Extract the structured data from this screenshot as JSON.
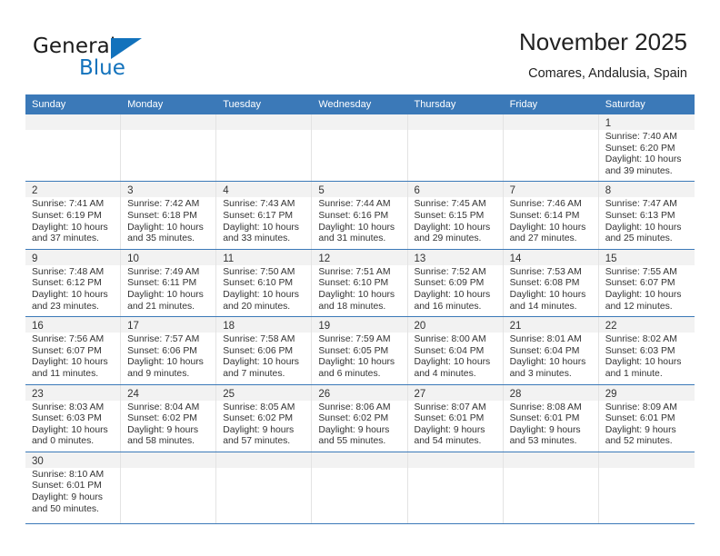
{
  "brand": {
    "name_top": "General",
    "name_bottom": "Blue",
    "accent_color": "#1272bc"
  },
  "header": {
    "title": "November 2025",
    "subtitle": "Comares, Andalusia, Spain"
  },
  "calendar": {
    "header_bg": "#3b79b8",
    "weekdays": [
      "Sunday",
      "Monday",
      "Tuesday",
      "Wednesday",
      "Thursday",
      "Friday",
      "Saturday"
    ],
    "weeks": [
      [
        {
          "day": "",
          "sunrise": "",
          "sunset": "",
          "daylight": "",
          "empty": true
        },
        {
          "day": "",
          "sunrise": "",
          "sunset": "",
          "daylight": "",
          "empty": true
        },
        {
          "day": "",
          "sunrise": "",
          "sunset": "",
          "daylight": "",
          "empty": true
        },
        {
          "day": "",
          "sunrise": "",
          "sunset": "",
          "daylight": "",
          "empty": true
        },
        {
          "day": "",
          "sunrise": "",
          "sunset": "",
          "daylight": "",
          "empty": true
        },
        {
          "day": "",
          "sunrise": "",
          "sunset": "",
          "daylight": "",
          "empty": true
        },
        {
          "day": "1",
          "sunrise": "Sunrise: 7:40 AM",
          "sunset": "Sunset: 6:20 PM",
          "daylight": "Daylight: 10 hours and 39 minutes.",
          "empty": false
        }
      ],
      [
        {
          "day": "2",
          "sunrise": "Sunrise: 7:41 AM",
          "sunset": "Sunset: 6:19 PM",
          "daylight": "Daylight: 10 hours and 37 minutes.",
          "empty": false
        },
        {
          "day": "3",
          "sunrise": "Sunrise: 7:42 AM",
          "sunset": "Sunset: 6:18 PM",
          "daylight": "Daylight: 10 hours and 35 minutes.",
          "empty": false
        },
        {
          "day": "4",
          "sunrise": "Sunrise: 7:43 AM",
          "sunset": "Sunset: 6:17 PM",
          "daylight": "Daylight: 10 hours and 33 minutes.",
          "empty": false
        },
        {
          "day": "5",
          "sunrise": "Sunrise: 7:44 AM",
          "sunset": "Sunset: 6:16 PM",
          "daylight": "Daylight: 10 hours and 31 minutes.",
          "empty": false
        },
        {
          "day": "6",
          "sunrise": "Sunrise: 7:45 AM",
          "sunset": "Sunset: 6:15 PM",
          "daylight": "Daylight: 10 hours and 29 minutes.",
          "empty": false
        },
        {
          "day": "7",
          "sunrise": "Sunrise: 7:46 AM",
          "sunset": "Sunset: 6:14 PM",
          "daylight": "Daylight: 10 hours and 27 minutes.",
          "empty": false
        },
        {
          "day": "8",
          "sunrise": "Sunrise: 7:47 AM",
          "sunset": "Sunset: 6:13 PM",
          "daylight": "Daylight: 10 hours and 25 minutes.",
          "empty": false
        }
      ],
      [
        {
          "day": "9",
          "sunrise": "Sunrise: 7:48 AM",
          "sunset": "Sunset: 6:12 PM",
          "daylight": "Daylight: 10 hours and 23 minutes.",
          "empty": false
        },
        {
          "day": "10",
          "sunrise": "Sunrise: 7:49 AM",
          "sunset": "Sunset: 6:11 PM",
          "daylight": "Daylight: 10 hours and 21 minutes.",
          "empty": false
        },
        {
          "day": "11",
          "sunrise": "Sunrise: 7:50 AM",
          "sunset": "Sunset: 6:10 PM",
          "daylight": "Daylight: 10 hours and 20 minutes.",
          "empty": false
        },
        {
          "day": "12",
          "sunrise": "Sunrise: 7:51 AM",
          "sunset": "Sunset: 6:10 PM",
          "daylight": "Daylight: 10 hours and 18 minutes.",
          "empty": false
        },
        {
          "day": "13",
          "sunrise": "Sunrise: 7:52 AM",
          "sunset": "Sunset: 6:09 PM",
          "daylight": "Daylight: 10 hours and 16 minutes.",
          "empty": false
        },
        {
          "day": "14",
          "sunrise": "Sunrise: 7:53 AM",
          "sunset": "Sunset: 6:08 PM",
          "daylight": "Daylight: 10 hours and 14 minutes.",
          "empty": false
        },
        {
          "day": "15",
          "sunrise": "Sunrise: 7:55 AM",
          "sunset": "Sunset: 6:07 PM",
          "daylight": "Daylight: 10 hours and 12 minutes.",
          "empty": false
        }
      ],
      [
        {
          "day": "16",
          "sunrise": "Sunrise: 7:56 AM",
          "sunset": "Sunset: 6:07 PM",
          "daylight": "Daylight: 10 hours and 11 minutes.",
          "empty": false
        },
        {
          "day": "17",
          "sunrise": "Sunrise: 7:57 AM",
          "sunset": "Sunset: 6:06 PM",
          "daylight": "Daylight: 10 hours and 9 minutes.",
          "empty": false
        },
        {
          "day": "18",
          "sunrise": "Sunrise: 7:58 AM",
          "sunset": "Sunset: 6:06 PM",
          "daylight": "Daylight: 10 hours and 7 minutes.",
          "empty": false
        },
        {
          "day": "19",
          "sunrise": "Sunrise: 7:59 AM",
          "sunset": "Sunset: 6:05 PM",
          "daylight": "Daylight: 10 hours and 6 minutes.",
          "empty": false
        },
        {
          "day": "20",
          "sunrise": "Sunrise: 8:00 AM",
          "sunset": "Sunset: 6:04 PM",
          "daylight": "Daylight: 10 hours and 4 minutes.",
          "empty": false
        },
        {
          "day": "21",
          "sunrise": "Sunrise: 8:01 AM",
          "sunset": "Sunset: 6:04 PM",
          "daylight": "Daylight: 10 hours and 3 minutes.",
          "empty": false
        },
        {
          "day": "22",
          "sunrise": "Sunrise: 8:02 AM",
          "sunset": "Sunset: 6:03 PM",
          "daylight": "Daylight: 10 hours and 1 minute.",
          "empty": false
        }
      ],
      [
        {
          "day": "23",
          "sunrise": "Sunrise: 8:03 AM",
          "sunset": "Sunset: 6:03 PM",
          "daylight": "Daylight: 10 hours and 0 minutes.",
          "empty": false
        },
        {
          "day": "24",
          "sunrise": "Sunrise: 8:04 AM",
          "sunset": "Sunset: 6:02 PM",
          "daylight": "Daylight: 9 hours and 58 minutes.",
          "empty": false
        },
        {
          "day": "25",
          "sunrise": "Sunrise: 8:05 AM",
          "sunset": "Sunset: 6:02 PM",
          "daylight": "Daylight: 9 hours and 57 minutes.",
          "empty": false
        },
        {
          "day": "26",
          "sunrise": "Sunrise: 8:06 AM",
          "sunset": "Sunset: 6:02 PM",
          "daylight": "Daylight: 9 hours and 55 minutes.",
          "empty": false
        },
        {
          "day": "27",
          "sunrise": "Sunrise: 8:07 AM",
          "sunset": "Sunset: 6:01 PM",
          "daylight": "Daylight: 9 hours and 54 minutes.",
          "empty": false
        },
        {
          "day": "28",
          "sunrise": "Sunrise: 8:08 AM",
          "sunset": "Sunset: 6:01 PM",
          "daylight": "Daylight: 9 hours and 53 minutes.",
          "empty": false
        },
        {
          "day": "29",
          "sunrise": "Sunrise: 8:09 AM",
          "sunset": "Sunset: 6:01 PM",
          "daylight": "Daylight: 9 hours and 52 minutes.",
          "empty": false
        }
      ],
      [
        {
          "day": "30",
          "sunrise": "Sunrise: 8:10 AM",
          "sunset": "Sunset: 6:01 PM",
          "daylight": "Daylight: 9 hours and 50 minutes.",
          "empty": false
        },
        {
          "day": "",
          "sunrise": "",
          "sunset": "",
          "daylight": "",
          "empty": true
        },
        {
          "day": "",
          "sunrise": "",
          "sunset": "",
          "daylight": "",
          "empty": true
        },
        {
          "day": "",
          "sunrise": "",
          "sunset": "",
          "daylight": "",
          "empty": true
        },
        {
          "day": "",
          "sunrise": "",
          "sunset": "",
          "daylight": "",
          "empty": true
        },
        {
          "day": "",
          "sunrise": "",
          "sunset": "",
          "daylight": "",
          "empty": true
        },
        {
          "day": "",
          "sunrise": "",
          "sunset": "",
          "daylight": "",
          "empty": true
        }
      ]
    ]
  }
}
